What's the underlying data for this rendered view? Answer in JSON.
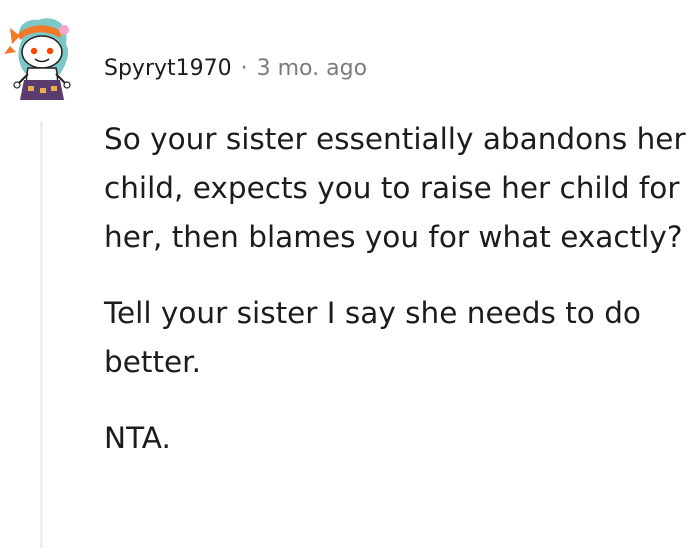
{
  "comment": {
    "author": "Spyryt1970",
    "separator": "·",
    "timestamp": "3 mo. ago",
    "avatar_icon": "snoo-avatar-icon",
    "paragraphs": [
      "So your sister essentially abandons her child, expects you to raise her child for her, then blames you for what exactly?",
      "Tell your sister I say she needs to do better.",
      "NTA."
    ]
  },
  "colors": {
    "text": "#1c1c1c",
    "meta": "#7c7c7c",
    "thread_line": "#edeff1"
  }
}
